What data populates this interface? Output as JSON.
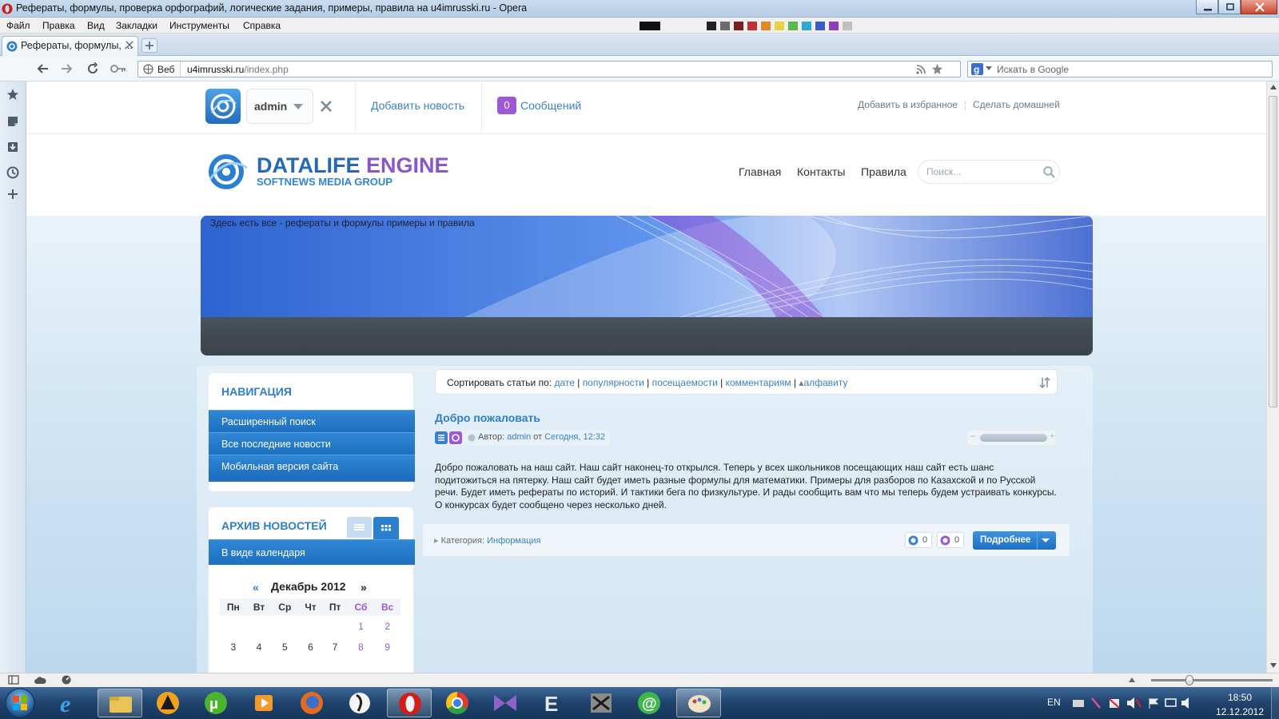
{
  "window": {
    "title": "Рефераты, формулы, проверка орфографий, логические задания, примеры, правила на u4imrusski.ru - Opera"
  },
  "menu": {
    "items": [
      "Файл",
      "Правка",
      "Вид",
      "Закладки",
      "Инструменты",
      "Справка"
    ]
  },
  "tab": {
    "title": "Рефераты, формулы, ..."
  },
  "address": {
    "scope": "Веб",
    "url_host": "u4imrusski.ru",
    "url_path": "/index.php",
    "search_placeholder": "Искать в Google"
  },
  "topbar": {
    "user": "admin",
    "add_news": "Добавить новость",
    "messages_count": "0",
    "messages_label": "Сообщений",
    "add_favorites": "Добавить в избранное",
    "make_home": "Сделать домашней"
  },
  "header": {
    "logo_main1": "DATALIFE",
    "logo_main2": "ENGINE",
    "logo_sub": "SOFTNEWS MEDIA GROUP",
    "nav": [
      "Главная",
      "Контакты",
      "Правила"
    ],
    "search_placeholder": "Поиск..."
  },
  "banner": {
    "caption": "Здесь есть все - рефераты и формулы примеры и правила"
  },
  "sidebar": {
    "nav_title": "НАВИГАЦИЯ",
    "nav_items": [
      "Расширенный поиск",
      "Все последние новости",
      "Мобильная версия сайта"
    ],
    "archive_title": "АРХИВ НОВОСТЕЙ",
    "archive_mode": "В виде календаря",
    "calendar": {
      "prev": "«",
      "next": "»",
      "month": "Декабрь 2012",
      "weekdays": [
        "Пн",
        "Вт",
        "Ср",
        "Чт",
        "Пт",
        "Сб",
        "Вс"
      ],
      "rows": [
        [
          "",
          "",
          "",
          "",
          "",
          "1",
          "2"
        ],
        [
          "3",
          "4",
          "5",
          "6",
          "7",
          "8",
          "9"
        ]
      ]
    }
  },
  "sort": {
    "label": "Сортировать статьи по:",
    "options": [
      "дате",
      "популярности",
      "посещаемости",
      "комментариям",
      "алфавиту"
    ]
  },
  "article": {
    "title": "Добро пожаловать",
    "author_label": "Автор:",
    "author": "admin",
    "date_prefix": "от",
    "date": "Сегодня, 12:32",
    "body": "Добро пожаловать на наш сайт. Наш сайт наконец-то открылся. Теперь у всех школьников посещающих наш сайт есть шанс подитожиться на пятерку. Наш сайт будет иметь разные формулы для математики. Примеры для разборов по Казахской и по Русской речи. Будет иметь рефераты по историй. И тактики бега по физкультуре. И рады сообщить вам что мы теперь будем устраивать конкурсы. О конкурсах будет сообщено через несколько дней.",
    "category_label": "Категория:",
    "category": "Информация",
    "comments": "0",
    "views": "0",
    "more": "Подробнее"
  },
  "taskbar": {
    "lang": "EN",
    "time": "18:50",
    "date": "12.12.2012"
  },
  "colors": {
    "accent_blue": "#3a82c4",
    "nav_blue": "#1e6fbf",
    "purple": "#9b59d6"
  }
}
